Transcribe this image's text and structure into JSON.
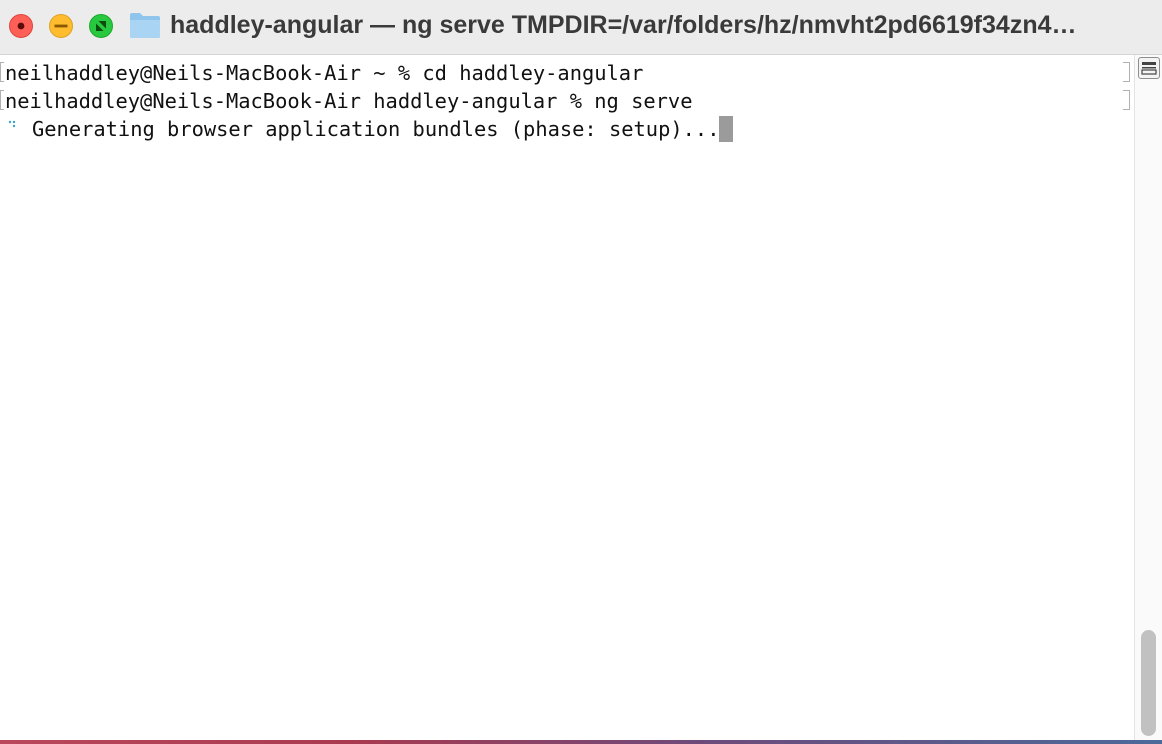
{
  "window": {
    "title": "haddley-angular — ng serve TMPDIR=/var/folders/hz/nmvht2pd6619f34zn4…",
    "folder_icon": "folder-icon"
  },
  "traffic_lights": {
    "close_color": "#fe5f57",
    "minimize_color": "#febc2e",
    "zoom_color": "#28c840"
  },
  "terminal": {
    "lines": [
      "neilhaddley@Neils-MacBook-Air ~ % cd haddley-angular",
      "neilhaddley@Neils-MacBook-Air haddley-angular % ng serve",
      "Generating browser application bundles (phase: setup)..."
    ],
    "spinner_glyph": "⠋",
    "cursor_color": "#9b9b9b",
    "spinner_color": "#35a6c9"
  }
}
